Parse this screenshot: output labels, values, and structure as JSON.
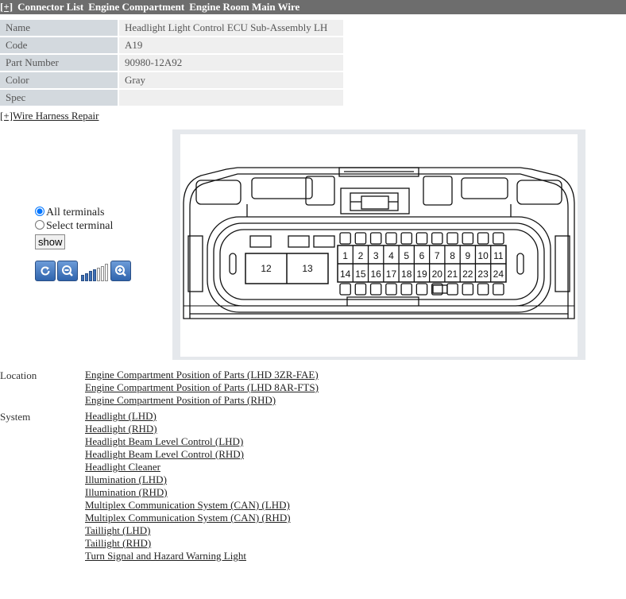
{
  "header": {
    "toggle": "[+]",
    "items": [
      "Connector List",
      "Engine Compartment",
      "Engine Room Main Wire"
    ]
  },
  "info": {
    "rows": [
      {
        "label": "Name",
        "value": "Headlight Light Control ECU Sub-Assembly LH"
      },
      {
        "label": "Code",
        "value": "A19"
      },
      {
        "label": "Part Number",
        "value": "90980-12A92"
      },
      {
        "label": "Color",
        "value": "Gray"
      },
      {
        "label": "Spec",
        "value": ""
      }
    ]
  },
  "wire_harness_link": "[+]Wire Harness Repair",
  "controls": {
    "all_terminals": "All terminals",
    "select_terminal": "Select terminal",
    "selected": "all",
    "show_button": "show",
    "zoom_level": 4,
    "zoom_steps": 7
  },
  "connector": {
    "terminals_left": [
      "12",
      "13"
    ],
    "terminals_top": [
      "1",
      "2",
      "3",
      "4",
      "5",
      "6",
      "7",
      "8",
      "9",
      "10",
      "11"
    ],
    "terminals_bottom": [
      "14",
      "15",
      "16",
      "17",
      "18",
      "19",
      "20",
      "21",
      "22",
      "23",
      "24"
    ]
  },
  "location": {
    "label": "Location",
    "links": [
      "Engine Compartment  Position of Parts (LHD 3ZR-FAE)",
      "Engine Compartment  Position of Parts (LHD 8AR-FTS)",
      "Engine Compartment  Position of Parts (RHD)"
    ]
  },
  "system": {
    "label": "System",
    "links": [
      "Headlight (LHD)",
      "Headlight (RHD)",
      "Headlight Beam Level Control (LHD)",
      "Headlight Beam Level Control (RHD)",
      "Headlight Cleaner",
      "Illumination (LHD)",
      "Illumination (RHD)",
      "Multiplex Communication System (CAN) (LHD)",
      "Multiplex Communication System (CAN) (RHD)",
      "Taillight (LHD)",
      "Taillight (RHD)",
      "Turn Signal and Hazard Warning Light"
    ]
  }
}
